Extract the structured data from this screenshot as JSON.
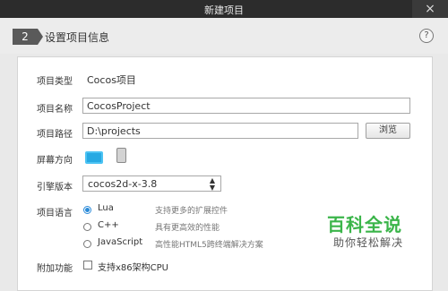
{
  "window": {
    "title": "新建项目",
    "close_glyph": "×"
  },
  "step": {
    "number": "2",
    "title": "设置项目信息",
    "help_glyph": "?"
  },
  "form": {
    "project_type": {
      "label": "项目类型",
      "value": "Cocos项目"
    },
    "project_name": {
      "label": "项目名称",
      "value": "CocosProject"
    },
    "project_path": {
      "label": "项目路径",
      "value": "D:\\projects",
      "browse_label": "浏览"
    },
    "orientation": {
      "label": "屏幕方向",
      "selected": "landscape"
    },
    "engine_version": {
      "label": "引擎版本",
      "value": "cocos2d-x-3.8"
    },
    "language": {
      "label": "项目语言",
      "options": [
        {
          "name": "Lua",
          "desc": "支持更多的扩展控件",
          "checked": true
        },
        {
          "name": "C++",
          "desc": "具有更高效的性能",
          "checked": false
        },
        {
          "name": "JavaScript",
          "desc": "高性能HTML5跨终端解决方案",
          "checked": false
        }
      ]
    },
    "extra": {
      "label": "附加功能",
      "option_label": "支持x86架构CPU",
      "checked": false
    }
  },
  "watermark": {
    "logo": "百科全说",
    "tagline": "助你轻松解决"
  },
  "colors": {
    "accent": "#27a9e3",
    "radio_active": "#2a8ad8",
    "watermark": "#3bb54a"
  }
}
